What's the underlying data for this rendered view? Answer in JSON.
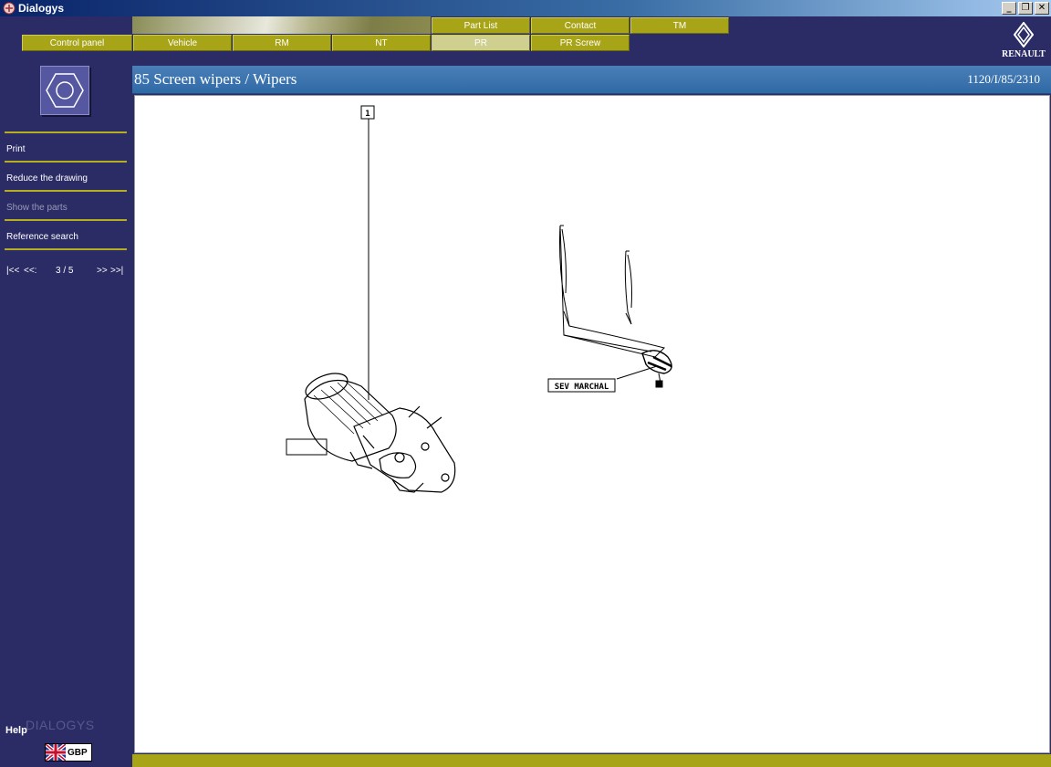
{
  "window": {
    "title": "Dialogys",
    "controls": [
      "_",
      "❐",
      "✕"
    ]
  },
  "tabs_top": [
    {
      "label": "Part List"
    },
    {
      "label": "Contact"
    },
    {
      "label": "TM"
    }
  ],
  "tabs_bottom": [
    {
      "label": "Control panel"
    },
    {
      "label": "Vehicle"
    },
    {
      "label": "RM"
    },
    {
      "label": "NT"
    },
    {
      "label": "PR",
      "active": true
    },
    {
      "label": "PR Screw"
    }
  ],
  "brand": {
    "name": "RENAULT"
  },
  "sidebar": {
    "items": [
      {
        "label": "Print",
        "enabled": true
      },
      {
        "label": "Reduce the drawing",
        "enabled": true
      },
      {
        "label": "Show the parts",
        "enabled": false
      },
      {
        "label": "Reference search",
        "enabled": true
      }
    ],
    "pager": {
      "first": "|<<",
      "prev": "<<:",
      "page": "3 / 5",
      "next": ">>",
      "last": ">>|"
    },
    "help": "Help",
    "watermark": "DIALOGYS",
    "language": "GBP"
  },
  "main": {
    "title": "85 Screen wipers / Wipers",
    "reference": "1120/I/85/2310"
  },
  "drawing": {
    "callout_1": "1",
    "callout_2": "",
    "callout_sev": "SEV MARCHAL"
  },
  "colors": {
    "background": "#2b2b66",
    "tab": "#a8a418",
    "tab_active": "#cfcf90",
    "header_blue": "#3a74b0",
    "separator": "#b5ae1e"
  }
}
